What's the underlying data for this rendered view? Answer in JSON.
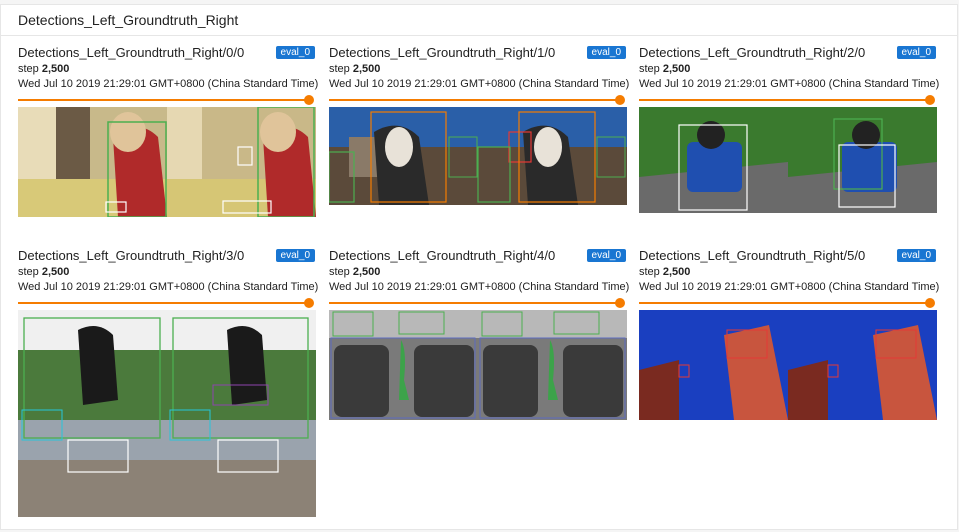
{
  "panel": {
    "title": "Detections_Left_Groundtruth_Right"
  },
  "step_label": "step",
  "cards": [
    {
      "title": "Detections_Left_Groundtruth_Right/0/0",
      "run": "eval_0",
      "step": "2,500",
      "time": "Wed Jul 10 2019 21:29:01 GMT+0800 (China Standard Time)",
      "slider_value": 1.0
    },
    {
      "title": "Detections_Left_Groundtruth_Right/1/0",
      "run": "eval_0",
      "step": "2,500",
      "time": "Wed Jul 10 2019 21:29:01 GMT+0800 (China Standard Time)",
      "slider_value": 1.0
    },
    {
      "title": "Detections_Left_Groundtruth_Right/2/0",
      "run": "eval_0",
      "step": "2,500",
      "time": "Wed Jul 10 2019 21:29:01 GMT+0800 (China Standard Time)",
      "slider_value": 1.0
    },
    {
      "title": "Detections_Left_Groundtruth_Right/3/0",
      "run": "eval_0",
      "step": "2,500",
      "time": "Wed Jul 10 2019 21:29:01 GMT+0800 (China Standard Time)",
      "slider_value": 1.0
    },
    {
      "title": "Detections_Left_Groundtruth_Right/4/0",
      "run": "eval_0",
      "step": "2,500",
      "time": "Wed Jul 10 2019 21:29:01 GMT+0800 (China Standard Time)",
      "slider_value": 1.0
    },
    {
      "title": "Detections_Left_Groundtruth_Right/5/0",
      "run": "eval_0",
      "step": "2,500",
      "time": "Wed Jul 10 2019 21:29:01 GMT+0800 (China Standard Time)",
      "slider_value": 1.0
    }
  ],
  "colors": {
    "accent": "#f57c00",
    "badge": "#1976d2",
    "box_green": "#4caf50",
    "box_white": "#ffffff"
  }
}
